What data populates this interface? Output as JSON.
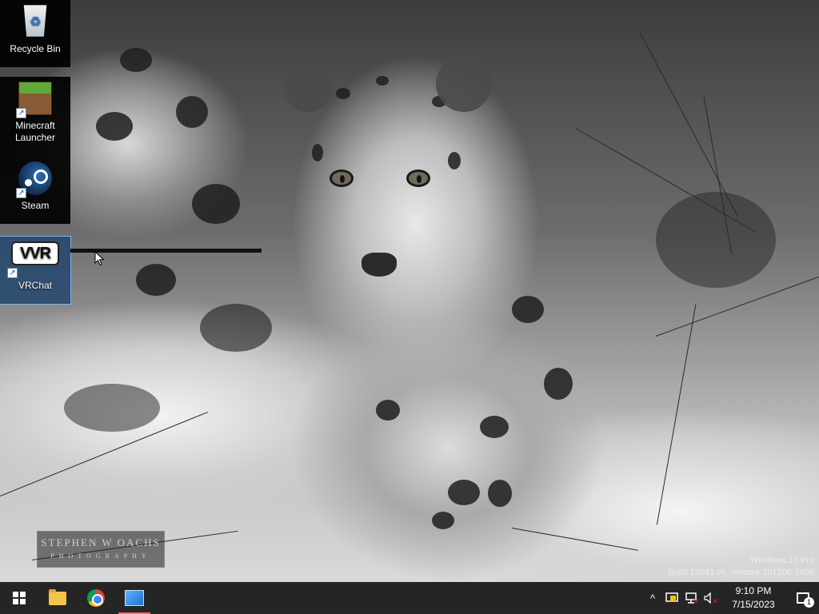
{
  "desktop": {
    "icons": [
      {
        "label": "Recycle Bin",
        "icon": "recycle-bin-icon",
        "shortcut": false
      },
      {
        "label": "Minecraft Launcher",
        "icon": "minecraft-icon",
        "shortcut": true
      },
      {
        "label": "Steam",
        "icon": "steam-icon",
        "shortcut": true
      },
      {
        "label": "VRChat",
        "icon": "vrchat-icon",
        "shortcut": true,
        "selected": true,
        "glyph_text": "VVR"
      }
    ],
    "wallpaper_watermark": {
      "line1": "STEPHEN W OACHS",
      "line2": "PHOTOGRAPHY"
    },
    "os_watermark": {
      "line1": "Windows 10 Pro",
      "line2": "Build 19041.vb_release.191206-1406"
    }
  },
  "taskbar": {
    "start": {
      "icon": "windows-logo-icon"
    },
    "pinned": [
      {
        "name": "file-explorer-icon"
      },
      {
        "name": "chrome-icon"
      },
      {
        "name": "installer-icon",
        "active": true
      }
    ],
    "tray": {
      "chevron": "^",
      "clock_time": "9:10 PM",
      "clock_date": "7/15/2023",
      "notification_count": "1"
    }
  },
  "colors": {
    "taskbar_bg": "#141414",
    "selection": "#234670",
    "active_indicator": "#e46b6b"
  }
}
